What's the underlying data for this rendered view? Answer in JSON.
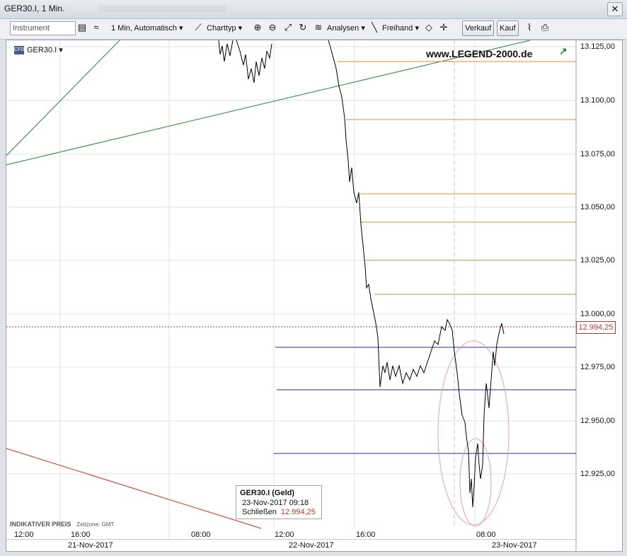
{
  "window": {
    "title": "GER30.I, 1 Min.",
    "close_glyph": "✕"
  },
  "toolbar": {
    "instrument_placeholder": "Instrument",
    "interval": "1 Min,  Automatisch",
    "charttyp": "Charttyp",
    "analysen": "Analysen",
    "freihand": "Freihand",
    "verkauf": "Verkauf",
    "kauf": "Kauf"
  },
  "chart": {
    "symbol": "GER30.I",
    "symbol_badge": "CFD",
    "watermark": "www.LEGEND-2000.de",
    "y_ticks": [
      "13.125,00",
      "13.100,00",
      "13.075,00",
      "13.050,00",
      "13.025,00",
      "13.000,00",
      "12.975,00",
      "12.950,00",
      "12.925,00"
    ],
    "current_price": "12.994,25",
    "x_time_labels": [
      "12:00",
      "16:00",
      "08:00",
      "12:00",
      "16:00",
      "08:00"
    ],
    "x_date_labels": [
      "21-Nov-2017",
      "22-Nov-2017",
      "23-Nov-2017"
    ],
    "footer_left": "INDIKATIVER PREIS",
    "footer_tz": "Zeitzone: GMT",
    "colors": {
      "price": "#000000",
      "fib": "#e08a3c",
      "support": "#2a2f8c",
      "trend_up": "#1f8a3a",
      "trend_down": "#d62c1a",
      "ellipse": "#e8a0b0",
      "price_line": "#c0392b"
    }
  },
  "chart_data": {
    "type": "line",
    "title": "GER30.I, 1 Min.",
    "ylim": [
      12900,
      13130
    ],
    "series": [
      {
        "name": "GER30.I",
        "x": [
          "22-Nov 14:00",
          "22-Nov 15:00",
          "22-Nov 16:00",
          "22-Nov 16:30",
          "22-Nov 17:00",
          "22-Nov 18:00",
          "22-Nov 20:00",
          "22-Nov 22:00",
          "23-Nov 04:00",
          "23-Nov 07:00",
          "23-Nov 08:00",
          "23-Nov 09:18"
        ],
        "values": [
          13120,
          13110,
          13060,
          13000,
          12967,
          12975,
          12972,
          12990,
          12998,
          12955,
          12915,
          12994.25
        ]
      }
    ],
    "horizontal_levels_fib": [
      13118,
      13091,
      13056,
      13043,
      13025,
      13009
    ],
    "horizontal_levels_support": [
      12984,
      12965,
      12935
    ]
  },
  "tooltip": {
    "title": "GER30.I (Geld)",
    "date": "23-Nov-2017 09:18",
    "close_label": "Schließen",
    "close_value": "12.994,25"
  }
}
